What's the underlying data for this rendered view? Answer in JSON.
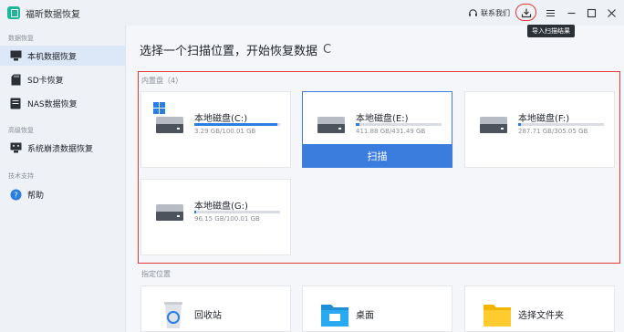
{
  "app": {
    "title": "福昕数据恢复"
  },
  "toolbar": {
    "contact_label": "联系我们",
    "export_tooltip": "导入扫描结果"
  },
  "sidebar": {
    "section_recovery": "数据恢复",
    "items": [
      {
        "label": "本机数据恢复",
        "icon": "computer-icon",
        "active": true
      },
      {
        "label": "SD卡恢复",
        "icon": "sd-card-icon"
      },
      {
        "label": "NAS数据恢复",
        "icon": "nas-icon"
      }
    ],
    "section_advanced": "高级恢复",
    "advanced_item": {
      "label": "系统崩溃数据恢复",
      "icon": "system-crash-icon"
    },
    "section_support": "技术支持",
    "help_item": {
      "label": "帮助",
      "icon": "help-icon"
    }
  },
  "main": {
    "heading": "选择一个扫描位置，开始恢复数据",
    "internal_label": "内置盘（4）",
    "drives": [
      {
        "name": "本地磁盘(C:)",
        "size": "3.29 GB/100.01 GB",
        "used": 0.97,
        "system": true
      },
      {
        "name": "本地磁盘(E:)",
        "size": "411.88 GB/431.49 GB",
        "used": 0.04,
        "selected": true
      },
      {
        "name": "本地磁盘(F:)",
        "size": "287.71 GB/305.05 GB",
        "used": 0.03
      },
      {
        "name": "本地磁盘(G:)",
        "size": "96.15 GB/100.01 GB",
        "used": 0.02
      }
    ],
    "scan_label": "扫描",
    "specified_label": "指定位置",
    "locations": [
      {
        "label": "回收站",
        "icon": "recycle-bin-icon"
      },
      {
        "label": "桌面",
        "icon": "desktop-folder-icon"
      },
      {
        "label": "选择文件夹",
        "icon": "folder-icon"
      }
    ]
  }
}
